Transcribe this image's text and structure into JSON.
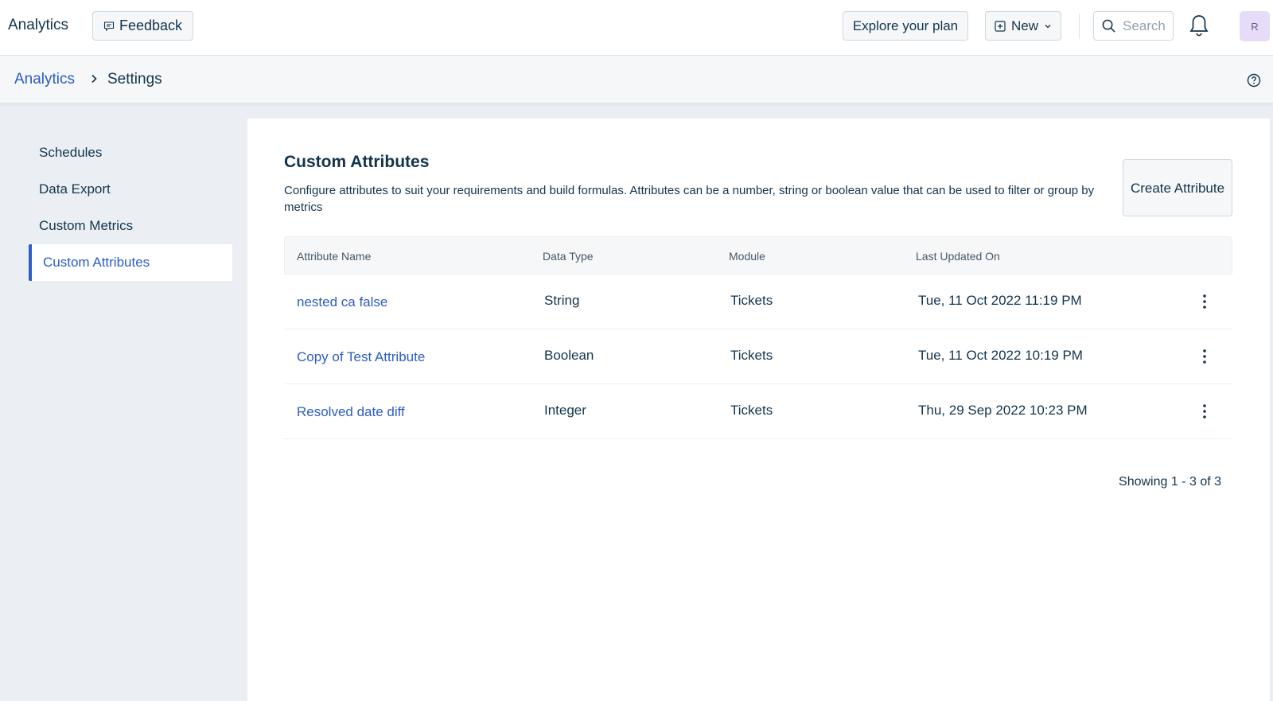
{
  "topbar": {
    "app_title": "Analytics",
    "feedback_label": "Feedback",
    "explore_label": "Explore your plan",
    "new_label": "New",
    "search_placeholder": "Search",
    "avatar_initial": "R"
  },
  "breadcrumb": {
    "root": "Analytics",
    "current": "Settings"
  },
  "sidebar": {
    "items": [
      {
        "label": "Schedules"
      },
      {
        "label": "Data Export"
      },
      {
        "label": "Custom Metrics"
      },
      {
        "label": "Custom Attributes",
        "active": true
      }
    ]
  },
  "main": {
    "title": "Custom Attributes",
    "description": "Configure attributes to suit your requirements and build formulas. Attributes can be a number, string or boolean value that can be used to filter or group by metrics",
    "create_button": "Create Attribute",
    "table": {
      "headers": [
        "Attribute Name",
        "Data Type",
        "Module",
        "Last Updated On"
      ],
      "rows": [
        {
          "name": "nested ca false",
          "type": "String",
          "module": "Tickets",
          "updated": "Tue, 11 Oct 2022 11:19 PM"
        },
        {
          "name": "Copy of Test Attribute",
          "type": "Boolean",
          "module": "Tickets",
          "updated": "Tue, 11 Oct 2022 10:19 PM"
        },
        {
          "name": "Resolved date diff",
          "type": "Integer",
          "module": "Tickets",
          "updated": "Thu, 29 Sep 2022 10:23 PM"
        }
      ]
    },
    "pagination_text": "Showing 1 - 3 of 3"
  },
  "colors": {
    "accent": "#2c5cc5",
    "text": "#12344d",
    "background": "#ebeff3",
    "avatar_bg": "#e6dcf7"
  },
  "icons": [
    "feedback-icon",
    "plus-square-icon",
    "chevron-down-icon",
    "search-icon",
    "bell-icon",
    "chevron-right-icon",
    "help-icon",
    "kebab-menu-icon"
  ]
}
